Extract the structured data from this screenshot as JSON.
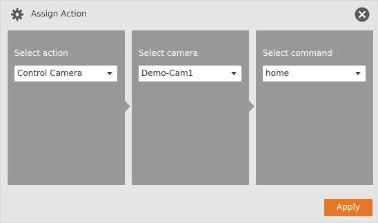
{
  "dialog": {
    "title": "Assign Action",
    "title_icon": "gear-icon",
    "close_icon": "close-icon"
  },
  "panels": [
    {
      "label": "Select action",
      "value": "Control Camera"
    },
    {
      "label": "Select camera",
      "value": "Demo-Cam1"
    },
    {
      "label": "Select command",
      "value": "home"
    }
  ],
  "footer": {
    "apply_label": "Apply"
  },
  "colors": {
    "dialog_bg": "#e6e6e6",
    "panel_bg": "#999999",
    "accent": "#e2782a",
    "close_bg": "#5a5a5a"
  }
}
